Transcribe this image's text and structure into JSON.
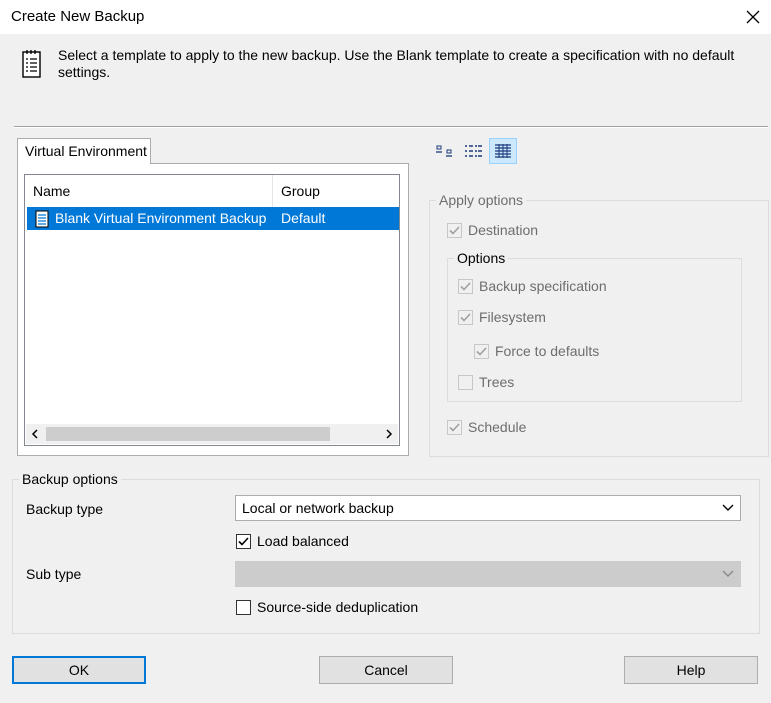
{
  "window": {
    "title": "Create New Backup"
  },
  "description": "Select a template to apply to the new backup. Use the Blank template to create a specification with no default settings.",
  "tabs": [
    {
      "label": "Virtual Environment"
    }
  ],
  "template_list": {
    "columns": {
      "name": "Name",
      "group": "Group"
    },
    "rows": [
      {
        "name": "Blank Virtual Environment Backup",
        "group": "Default",
        "selected": true
      }
    ]
  },
  "view_buttons": [
    "large-icons-view-icon",
    "list-view-icon",
    "details-view-icon"
  ],
  "apply_options": {
    "legend": "Apply options",
    "destination": {
      "label": "Destination",
      "checked": true
    },
    "options_group": {
      "legend": "Options",
      "backup_specification": {
        "label": "Backup specification",
        "checked": true
      },
      "filesystem": {
        "label": "Filesystem",
        "checked": true
      },
      "force_to_defaults": {
        "label": "Force to defaults",
        "checked": true
      },
      "trees": {
        "label": "Trees",
        "checked": false
      }
    },
    "schedule": {
      "label": "Schedule",
      "checked": true
    }
  },
  "backup_options": {
    "legend": "Backup options",
    "backup_type_label": "Backup type",
    "backup_type_value": "Local or network backup",
    "load_balanced": {
      "label": "Load balanced",
      "checked": true
    },
    "sub_type_label": "Sub type",
    "sub_type_value": "",
    "source_side_dedup": {
      "label": "Source-side deduplication",
      "checked": false
    }
  },
  "buttons": {
    "ok": "OK",
    "cancel": "Cancel",
    "help": "Help"
  },
  "colors": {
    "selection": "#0078d7",
    "active_view": "#cce8ff"
  }
}
